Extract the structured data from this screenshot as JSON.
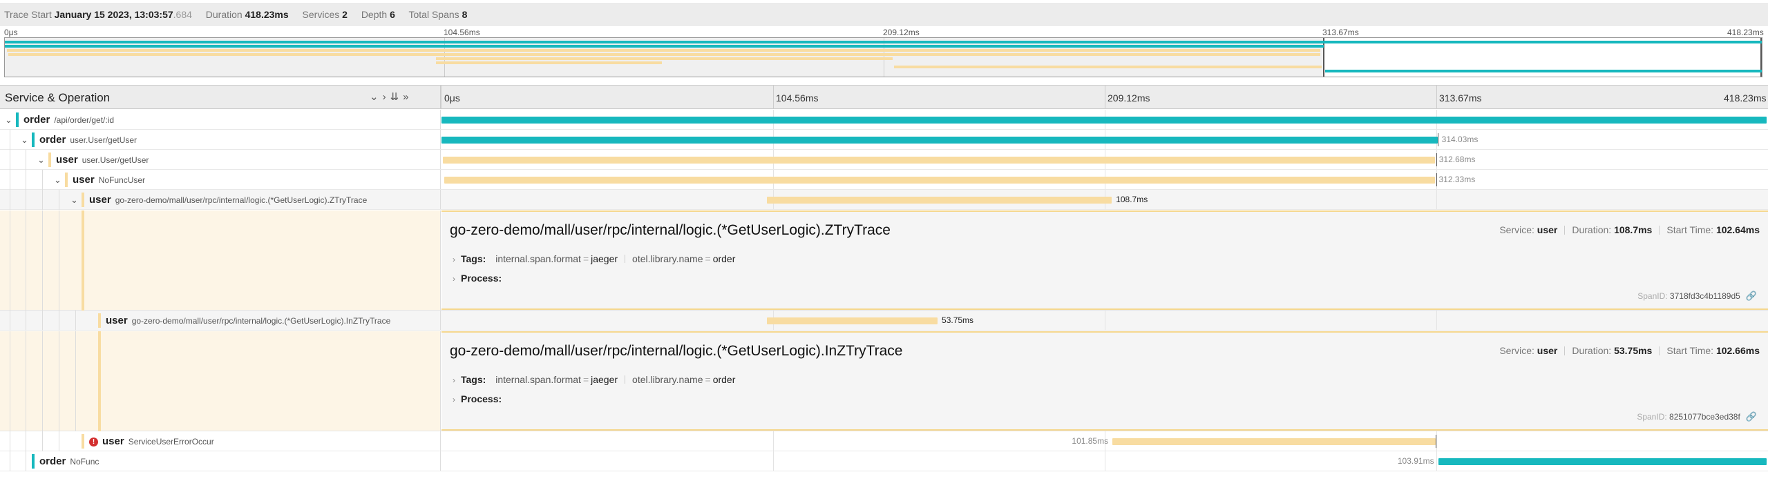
{
  "header": {
    "trace_start_label": "Trace Start",
    "trace_start_date": "January 15 2023, 13:03:57",
    "trace_start_ms": ".684",
    "duration_label": "Duration",
    "duration": "418.23ms",
    "services_label": "Services",
    "services": "2",
    "depth_label": "Depth",
    "depth": "6",
    "total_spans_label": "Total Spans",
    "total_spans": "8"
  },
  "ticks": [
    "0μs",
    "104.56ms",
    "209.12ms",
    "313.67ms",
    "418.23ms"
  ],
  "timeline_header": {
    "title": "Service & Operation",
    "controls": [
      "⌄",
      "›",
      "⇊",
      "»"
    ]
  },
  "colors": {
    "order": "#17b8be",
    "user": "#f8dca1",
    "error": "#d32f2f"
  },
  "rows": [
    {
      "service": "order",
      "operation": "/api/order/get/:id",
      "label": ""
    },
    {
      "service": "order",
      "operation": "user.User/getUser",
      "label": "314.03ms"
    },
    {
      "service": "user",
      "operation": "user.User/getUser",
      "label": "312.68ms"
    },
    {
      "service": "user",
      "operation": "NoFuncUser",
      "label": "312.33ms"
    },
    {
      "service": "user",
      "operation": "go-zero-demo/mall/user/rpc/internal/logic.(*GetUserLogic).ZTryTrace",
      "label": "108.7ms"
    },
    {
      "service": "user",
      "operation": "go-zero-demo/mall/user/rpc/internal/logic.(*GetUserLogic).InZTryTrace",
      "label": "53.75ms"
    },
    {
      "service": "user",
      "operation": "ServiceUserErrorOccur",
      "label": "101.85ms"
    },
    {
      "service": "order",
      "operation": "NoFunc",
      "label": "103.91ms"
    }
  ],
  "details": [
    {
      "title": "go-zero-demo/mall/user/rpc/internal/logic.(*GetUserLogic).ZTryTrace",
      "service_label": "Service:",
      "service": "user",
      "duration_label": "Duration:",
      "duration": "108.7ms",
      "start_label": "Start Time:",
      "start": "102.64ms",
      "tags_label": "Tags:",
      "tag1_key": "internal.span.format",
      "tag1_val": "jaeger",
      "tag2_key": "otel.library.name",
      "tag2_val": "order",
      "process_label": "Process:",
      "spanid_label": "SpanID:",
      "spanid": "3718fd3c4b1189d5"
    },
    {
      "title": "go-zero-demo/mall/user/rpc/internal/logic.(*GetUserLogic).InZTryTrace",
      "service_label": "Service:",
      "service": "user",
      "duration_label": "Duration:",
      "duration": "53.75ms",
      "start_label": "Start Time:",
      "start": "102.66ms",
      "tags_label": "Tags:",
      "tag1_key": "internal.span.format",
      "tag1_val": "jaeger",
      "tag2_key": "otel.library.name",
      "tag2_val": "order",
      "process_label": "Process:",
      "spanid_label": "SpanID:",
      "spanid": "8251077bce3ed38f"
    }
  ],
  "spans": [
    {
      "service": "order",
      "start_ms": 0,
      "duration_ms": 418.23
    },
    {
      "service": "order",
      "start_ms": 0,
      "duration_ms": 314.03
    },
    {
      "service": "user",
      "start_ms": 0.5,
      "duration_ms": 312.68
    },
    {
      "service": "user",
      "start_ms": 0.8,
      "duration_ms": 312.33
    },
    {
      "service": "user",
      "start_ms": 102.64,
      "duration_ms": 108.7
    },
    {
      "service": "user",
      "start_ms": 102.66,
      "duration_ms": 53.75
    },
    {
      "service": "user",
      "start_ms": 211.6,
      "duration_ms": 101.85
    },
    {
      "service": "order",
      "start_ms": 314.3,
      "duration_ms": 103.91
    }
  ]
}
